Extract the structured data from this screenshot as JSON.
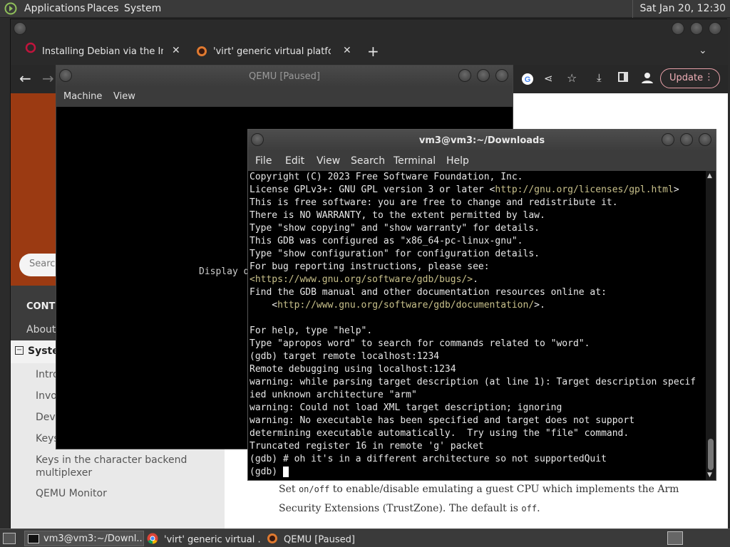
{
  "topbar": {
    "applications": "Applications",
    "places": "Places",
    "system": "System",
    "clock": "Sat Jan 20, 12:30"
  },
  "browser": {
    "tabs": [
      {
        "title": "Installing Debian via the Intern"
      },
      {
        "title": "'virt' generic virtual platform ("
      }
    ],
    "update_label": "Update",
    "sidebar": {
      "search_placeholder": "Search",
      "contents": "CONTE",
      "about": "About",
      "system": "Syste",
      "items": [
        "Intro",
        "Invo",
        "Devi",
        "Keys",
        "Keys in the character backend multiplexer",
        "QEMU Monitor"
      ]
    },
    "page": {
      "line1_pre": "Set ",
      "line1_code": "on/off",
      "line1_post": " to enable/disable emulating a guest CPU which implements the Arm",
      "line2_pre": "Security Extensions (TrustZone). The default is ",
      "line2_code": "off",
      "line2_post": "."
    }
  },
  "qemu": {
    "title": "QEMU [Paused]",
    "menu": [
      "Machine",
      "View"
    ],
    "screen_text": "Display d"
  },
  "terminal": {
    "title": "vm3@vm3:~/Downloads",
    "menu": [
      "File",
      "Edit",
      "View",
      "Search",
      "Terminal",
      "Help"
    ],
    "lines": [
      {
        "text": "Copyright (C) 2023 Free Software Foundation, Inc."
      },
      {
        "text": "License GPLv3+: GNU GPL version 3 or later <",
        "link": "http://gnu.org/licenses/gpl.html",
        "after": ">"
      },
      {
        "text": "This is free software: you are free to change and redistribute it."
      },
      {
        "text": "There is NO WARRANTY, to the extent permitted by law."
      },
      {
        "text": "Type \"show copying\" and \"show warranty\" for details."
      },
      {
        "text": "This GDB was configured as \"x86_64-pc-linux-gnu\"."
      },
      {
        "text": "Type \"show configuration\" for configuration details."
      },
      {
        "text": "For bug reporting instructions, please see:"
      },
      {
        "text": "",
        "link": "<https://www.gnu.org/software/gdb/bugs/>",
        "after": "."
      },
      {
        "text": "Find the GDB manual and other documentation resources online at:"
      },
      {
        "text": "    <",
        "link": "http://www.gnu.org/software/gdb/documentation/",
        "after": ">."
      },
      {
        "text": ""
      },
      {
        "text": "For help, type \"help\"."
      },
      {
        "text": "Type \"apropos word\" to search for commands related to \"word\"."
      },
      {
        "text": "(gdb) target remote localhost:1234"
      },
      {
        "text": "Remote debugging using localhost:1234"
      },
      {
        "text": "warning: while parsing target description (at line 1): Target description specif"
      },
      {
        "text": "ied unknown architecture \"arm\""
      },
      {
        "text": "warning: Could not load XML target description; ignoring"
      },
      {
        "text": "warning: No executable has been specified and target does not support"
      },
      {
        "text": "determining executable automatically.  Try using the \"file\" command."
      },
      {
        "text": "Truncated register 16 in remote 'g' packet"
      },
      {
        "text": "(gdb) # oh it's in a different architecture so not supportedQuit"
      },
      {
        "text": "(gdb) "
      }
    ]
  },
  "taskbar": {
    "items": [
      "vm3@vm3:~/Downl...",
      "'virt' generic virtual ...",
      "QEMU [Paused]"
    ]
  },
  "colors": {
    "accent_orange": "#9b3a12",
    "link": "#c8c08a",
    "update_pill": "#e8a0a8"
  }
}
